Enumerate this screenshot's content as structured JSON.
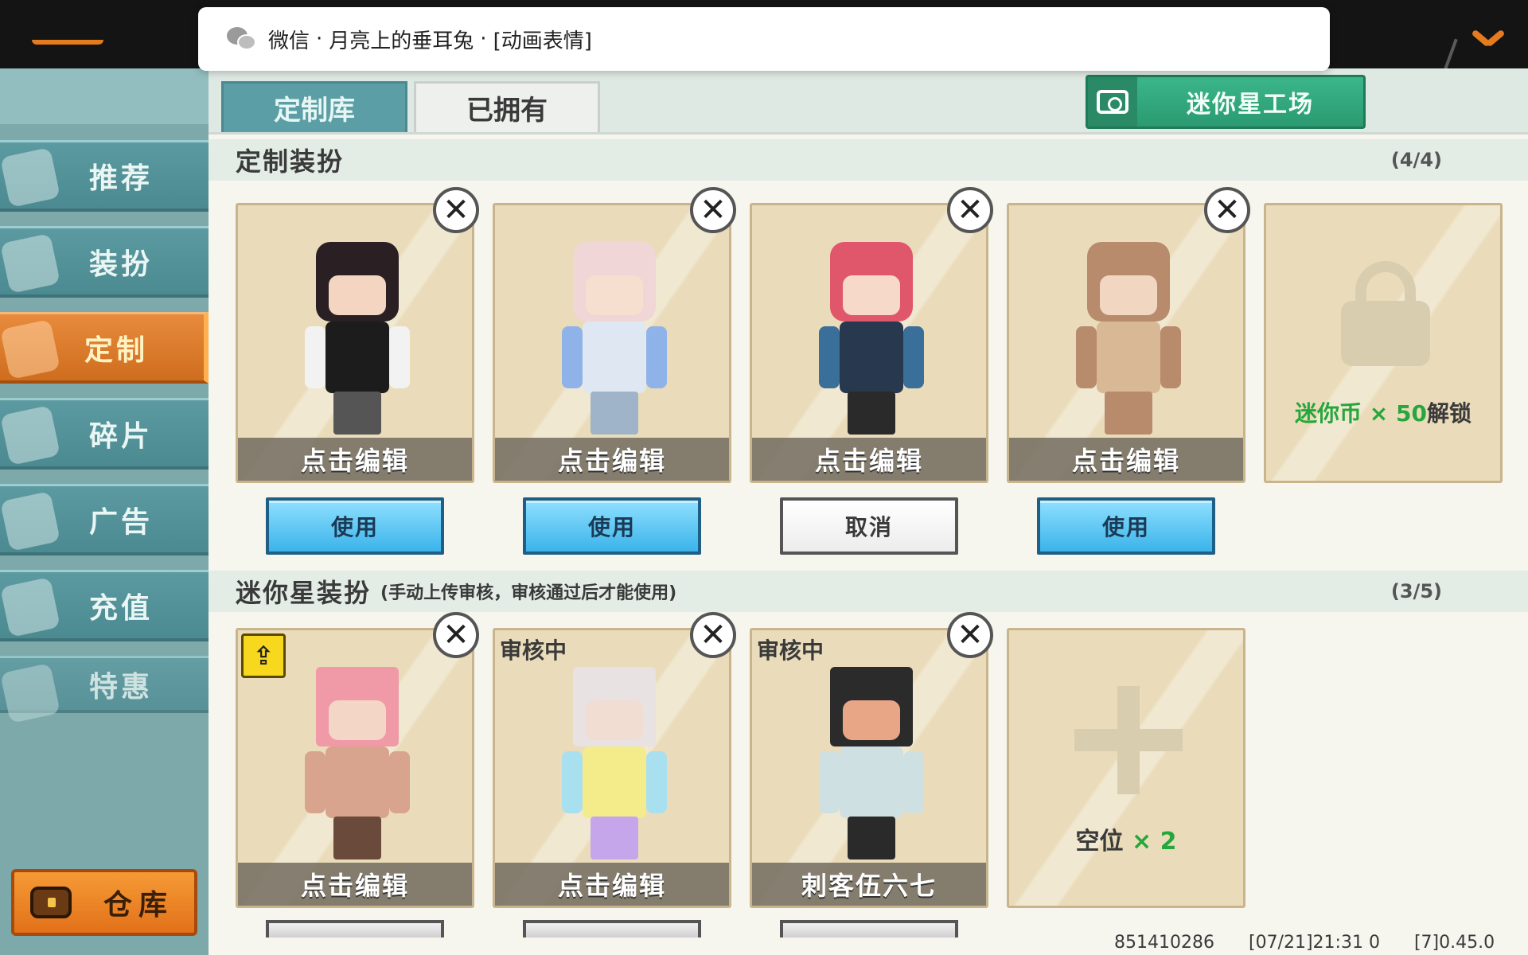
{
  "notification": {
    "app": "微信",
    "sep": "·",
    "sender": "月亮上的垂耳兔",
    "message": "[动画表情]"
  },
  "sidebar": {
    "items": [
      {
        "label": "推荐",
        "icon": "thumbs-up-icon"
      },
      {
        "label": "装扮",
        "icon": "shirt-icon"
      },
      {
        "label": "定制",
        "icon": "pencil-icon"
      },
      {
        "label": "碎片",
        "icon": "puzzle-icon"
      },
      {
        "label": "广告",
        "icon": "gift-icon"
      },
      {
        "label": "充值",
        "icon": "coins-icon"
      },
      {
        "label": "特惠",
        "icon": "sale-icon"
      }
    ],
    "active": "定制",
    "warehouse_label": "仓库"
  },
  "tabs": [
    "定制库",
    "已拥有"
  ],
  "studio_button": "迷你星工场",
  "section_custom": {
    "title": "定制装扮",
    "count": "(4/4)",
    "cards": [
      {
        "edit": "点击编辑",
        "action": "使用"
      },
      {
        "edit": "点击编辑",
        "action": "使用"
      },
      {
        "edit": "点击编辑",
        "action": "取消"
      },
      {
        "edit": "点击编辑",
        "action": "使用"
      }
    ],
    "locked": {
      "currency": "迷你币",
      "times": "×",
      "amount": "50",
      "suffix": "解锁"
    }
  },
  "section_star": {
    "title": "迷你星装扮",
    "note": "(手动上传审核，审核通过后才能使用)",
    "count": "(3/5)",
    "cards": [
      {
        "status": "",
        "label": "点击编辑"
      },
      {
        "status": "审核中",
        "label": "点击编辑"
      },
      {
        "status": "审核中",
        "label": "刺客伍六七"
      }
    ],
    "empty": {
      "text": "空位",
      "times": "×",
      "count": "2"
    }
  },
  "footer": {
    "uid": "851410286",
    "time": "[07/21]21:31 0",
    "version": "[7]0.45.0"
  },
  "colors": {
    "active_tab": "#5b9ea5",
    "active_side": "#e57a1e",
    "use_button": "#3bb3ea",
    "green_text": "#26a63c"
  }
}
